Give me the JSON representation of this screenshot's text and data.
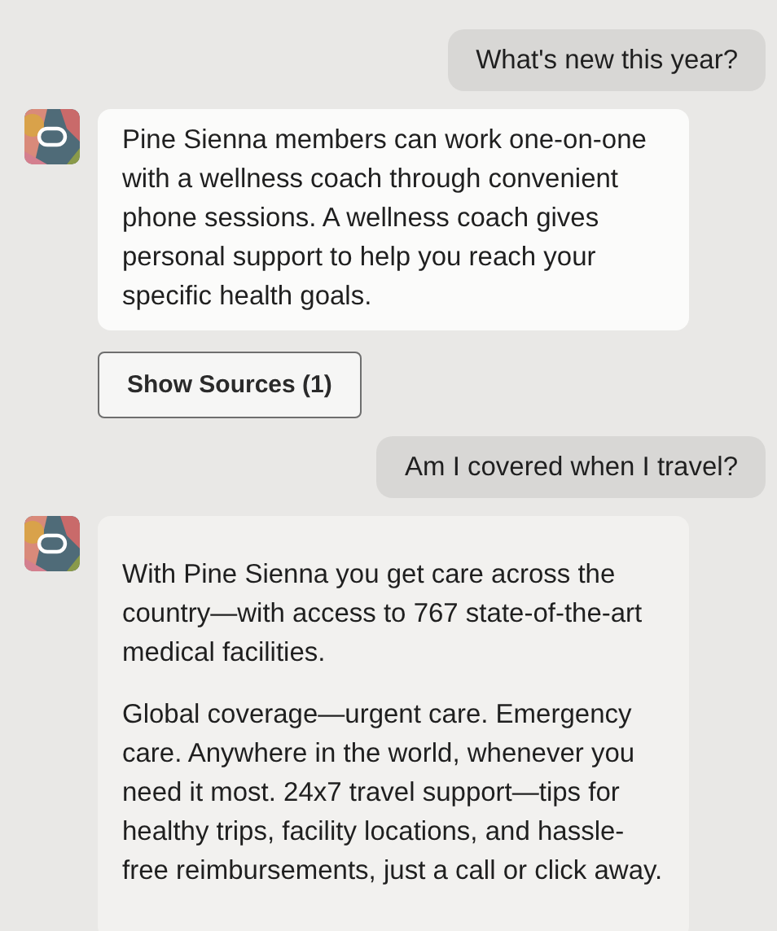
{
  "messages": [
    {
      "kind": "user",
      "text": "What's new this year?"
    },
    {
      "kind": "bot",
      "paragraphs": [
        "Pine Sienna members can work one-on-one with a wellness coach through convenient phone sessions. A wellness coach gives personal support to help you reach your specific health goals."
      ],
      "button": "Show Sources (1)"
    },
    {
      "kind": "user",
      "text": "Am I covered when I travel?"
    },
    {
      "kind": "bot",
      "paragraphs": [
        "With Pine Sienna you get care across the country—with access to 767 state-of-the-art medical facilities.",
        "Global coverage—urgent care. Emergency care. Anywhere in the world, whenever you need it most. 24x7 travel support—tips for healthy trips, facility locations, and hassle-free reimbursements, just a call or click away."
      ]
    }
  ]
}
